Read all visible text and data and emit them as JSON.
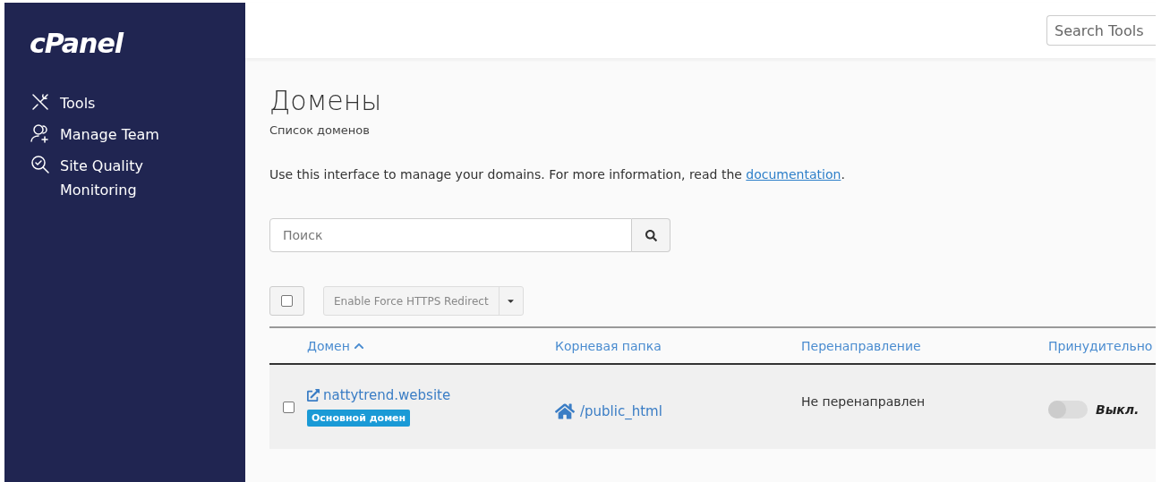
{
  "sidebar": {
    "logo": "cPanel",
    "items": [
      {
        "kind": "tools",
        "label": "Tools"
      },
      {
        "kind": "team",
        "label": "Manage Team"
      },
      {
        "kind": "quality",
        "label": "Site Quality Monitoring"
      }
    ]
  },
  "header": {
    "search": {
      "placeholder": "Search Tools"
    }
  },
  "page": {
    "title": "Домены",
    "subtitle": "Список доменов",
    "description": "Use this interface to manage your domains. For more information, read the ",
    "link": "documentation",
    "after_link": "."
  },
  "search": {
    "placeholder": "Поиск"
  },
  "toolbar": {
    "select_all": {
      "checked": false
    },
    "action": "Enable Force HTTPS Redirect"
  },
  "table": {
    "columns": [
      {
        "label": "Домен",
        "sorted": true
      },
      {
        "label": "Корневая папка",
        "sorted": false
      },
      {
        "label": "Перенаправление",
        "sorted": false
      },
      {
        "label": "Принудительно",
        "sorted": false
      }
    ],
    "rows": [
      {
        "checked": false,
        "domain": "nattytrend.website",
        "badge": "Основной домен",
        "root": "/public_html",
        "redirect": "Не перенаправлен",
        "force_https": {
          "on": false,
          "label": "Выкл."
        }
      }
    ]
  }
}
